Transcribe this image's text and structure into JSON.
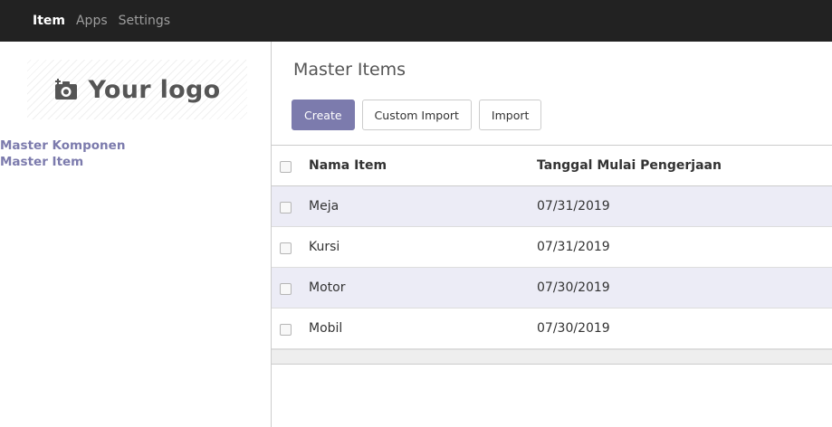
{
  "topbar": {
    "items": [
      {
        "label": "Item",
        "active": true
      },
      {
        "label": "Apps",
        "active": false
      },
      {
        "label": "Settings",
        "active": false
      }
    ]
  },
  "sidebar": {
    "logo_text": "Your logo",
    "logo_icon": "camera-icon",
    "menu": [
      {
        "label": "Master Komponen"
      },
      {
        "label": "Master Item"
      }
    ]
  },
  "main": {
    "title": "Master Items",
    "buttons": {
      "create": "Create",
      "custom_import": "Custom Import",
      "import": "Import"
    },
    "table": {
      "headers": {
        "name": "Nama Item",
        "date": "Tanggal Mulai Pengerjaan"
      },
      "rows": [
        {
          "name": "Meja",
          "date": "07/31/2019"
        },
        {
          "name": "Kursi",
          "date": "07/31/2019"
        },
        {
          "name": "Motor",
          "date": "07/30/2019"
        },
        {
          "name": "Mobil",
          "date": "07/30/2019"
        }
      ]
    }
  },
  "colors": {
    "topbar_bg": "#222222",
    "accent": "#7c7bad",
    "row_highlight": "#ececf6"
  }
}
